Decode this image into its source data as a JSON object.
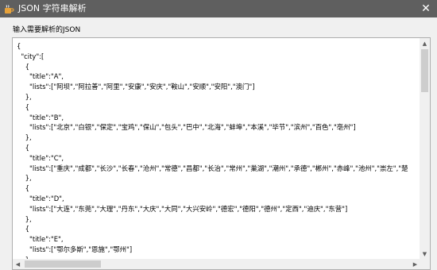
{
  "window": {
    "title": "JSON 字符串解析",
    "close_label": "✕",
    "icon": "app-cup-icon"
  },
  "input": {
    "label": "输入需要解析的JSON"
  },
  "code_lines": [
    "{",
    "  \"city\":[",
    "    {",
    "      \"title\":\"A\",",
    "      \"lists\":[\"阿坝\",\"阿拉善\",\"阿里\",\"安康\",\"安庆\",\"鞍山\",\"安顺\",\"安阳\",\"澳门\"]",
    "    },",
    "    {",
    "      \"title\":\"B\",",
    "      \"lists\":[\"北京\",\"白银\",\"保定\",\"宝鸡\",\"保山\",\"包头\",\"巴中\",\"北海\",\"蚌埠\",\"本溪\",\"毕节\",\"滨州\",\"百色\",\"亳州\"]",
    "    },",
    "    {",
    "      \"title\":\"C\",",
    "      \"lists\":[\"重庆\",\"成都\",\"长沙\",\"长春\",\"沧州\",\"常德\",\"昌都\",\"长治\",\"常州\",\"巢湖\",\"潮州\",\"承德\",\"郴州\",\"赤峰\",\"池州\",\"崇左\",\"楚",
    "    },",
    "    {",
    "      \"title\":\"D\",",
    "      \"lists\":[\"大连\",\"东莞\",\"大理\",\"丹东\",\"大庆\",\"大同\",\"大兴安岭\",\"德宏\",\"德阳\",\"德州\",\"定西\",\"迪庆\",\"东营\"]",
    "    },",
    "    {",
    "      \"title\":\"E\",",
    "      \"lists\":[\"鄂尔多斯\",\"恩施\",\"鄂州\"]",
    "    },"
  ],
  "scrollbars": {
    "vertical_up": "▲",
    "vertical_down": "▼",
    "horizontal_left": "◀",
    "horizontal_right": "▶"
  }
}
